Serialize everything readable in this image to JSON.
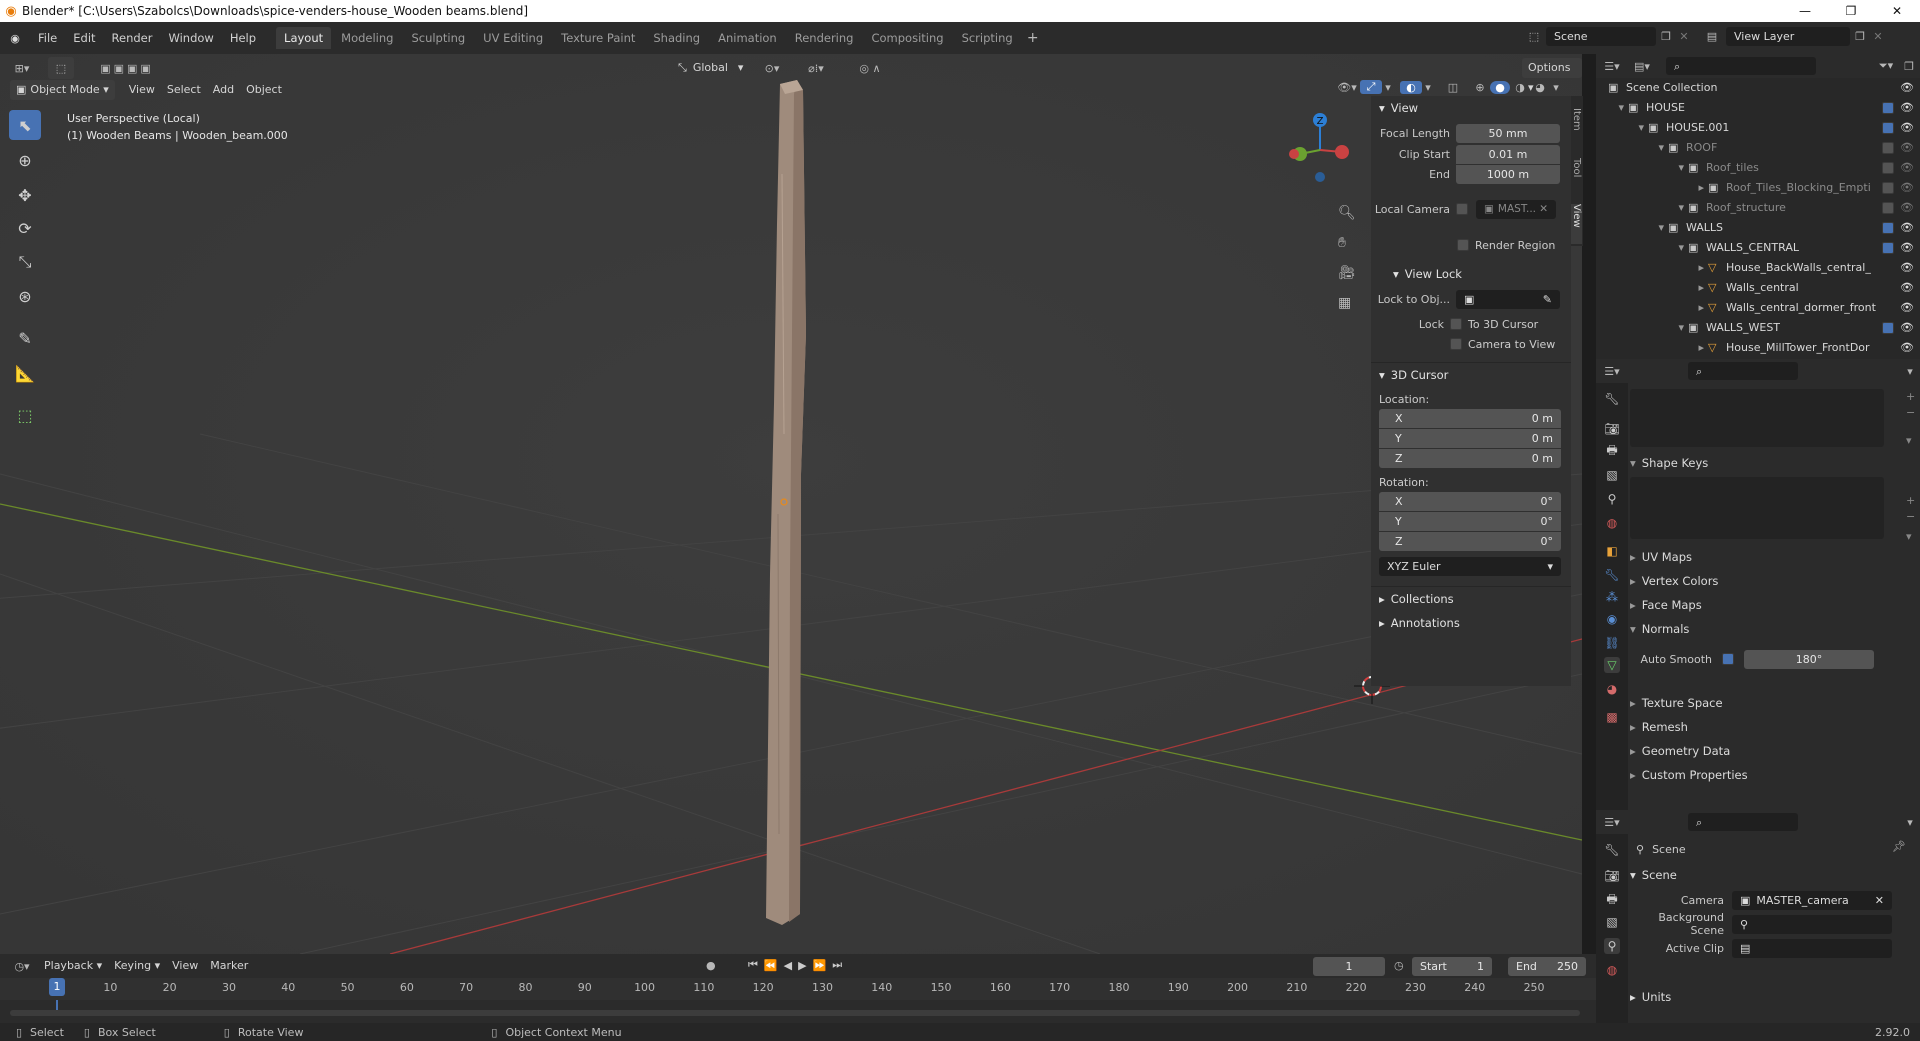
{
  "title_bar": {
    "text": "Blender* [C:\\Users\\Szabolcs\\Downloads\\spice-venders-house_Wooden beams.blend]"
  },
  "menu": [
    "File",
    "Edit",
    "Render",
    "Window",
    "Help"
  ],
  "workspaces": [
    "Layout",
    "Modeling",
    "Sculpting",
    "UV Editing",
    "Texture Paint",
    "Shading",
    "Animation",
    "Rendering",
    "Compositing",
    "Scripting"
  ],
  "active_workspace": "Layout",
  "scene": {
    "name": "Scene",
    "view_layer": "View Layer"
  },
  "viewport": {
    "header": {
      "mode": "Object Mode",
      "menus": [
        "View",
        "Select",
        "Add",
        "Object"
      ],
      "orientation": "Global",
      "options": "Options"
    },
    "info_line1": "User Perspective (Local)",
    "info_line2": "(1) Wooden Beams | Wooden_beam.000",
    "gizmo": {
      "x": "X",
      "y": "Y",
      "z": "Z"
    }
  },
  "npanel": {
    "tabs": [
      "Item",
      "Tool",
      "View"
    ],
    "view": {
      "title": "View",
      "focal_length_label": "Focal Length",
      "focal_length": "50 mm",
      "clip_start_label": "Clip Start",
      "clip_start": "0.01 m",
      "end_label": "End",
      "end": "1000 m",
      "local_camera_label": "Local Camera",
      "local_camera": "MAST...",
      "render_region": "Render Region"
    },
    "view_lock": {
      "title": "View Lock",
      "lock_to_obj": "Lock to Obj...",
      "lock_label": "Lock",
      "to_3d_cursor": "To 3D Cursor",
      "camera_to_view": "Camera to View"
    },
    "cursor": {
      "title": "3D Cursor",
      "location_label": "Location:",
      "loc_x": "0 m",
      "loc_y": "0 m",
      "loc_z": "0 m",
      "rotation_label": "Rotation:",
      "rot_x": "0°",
      "rot_y": "0°",
      "rot_z": "0°",
      "mode": "XYZ Euler",
      "axis_x": "X",
      "axis_y": "Y",
      "axis_z": "Z"
    },
    "collections": "Collections",
    "annotations": "Annotations"
  },
  "outliner": {
    "rows": [
      {
        "label": "Scene Collection",
        "indent": 0
      },
      {
        "label": "HOUSE",
        "indent": 1
      },
      {
        "label": "HOUSE.001",
        "indent": 2
      },
      {
        "label": "ROOF",
        "indent": 3
      },
      {
        "label": "Roof_tiles",
        "indent": 4
      },
      {
        "label": "Roof_Tiles_Blocking_Empti",
        "indent": 5
      },
      {
        "label": "Roof_structure",
        "indent": 4
      },
      {
        "label": "WALLS",
        "indent": 3
      },
      {
        "label": "WALLS_CENTRAL",
        "indent": 4
      },
      {
        "label": "House_BackWalls_central_",
        "indent": 5
      },
      {
        "label": "Walls_central",
        "indent": 5
      },
      {
        "label": "Walls_central_dormer_front",
        "indent": 5
      },
      {
        "label": "WALLS_WEST",
        "indent": 4
      },
      {
        "label": "House_MillTower_FrontDor",
        "indent": 5
      }
    ]
  },
  "properties": {
    "sections": [
      "Shape Keys",
      "UV Maps",
      "Vertex Colors",
      "Face Maps",
      "Normals",
      "Texture Space",
      "Remesh",
      "Geometry Data",
      "Custom Properties"
    ],
    "auto_smooth_label": "Auto Smooth",
    "auto_smooth_value": "180°"
  },
  "scene_props": {
    "title": "Scene",
    "section": "Scene",
    "camera_label": "Camera",
    "camera": "MASTER_camera",
    "background_scene": "Background Scene",
    "active_clip": "Active Clip",
    "units": "Units"
  },
  "timeline": {
    "menus": [
      "Playback",
      "Keying",
      "View",
      "Marker"
    ],
    "current_frame": "1",
    "start_label": "Start",
    "start": "1",
    "end_label": "End",
    "end": "250",
    "ticks": [
      "1",
      "10",
      "20",
      "30",
      "40",
      "50",
      "60",
      "70",
      "80",
      "90",
      "100",
      "110",
      "120",
      "130",
      "140",
      "150",
      "160",
      "170",
      "180",
      "190",
      "200",
      "210",
      "220",
      "230",
      "240",
      "250"
    ]
  },
  "status": {
    "select": "Select",
    "box_select": "Box Select",
    "rotate_view": "Rotate View",
    "context_menu": "Object Context Menu",
    "version": "2.92.0"
  }
}
